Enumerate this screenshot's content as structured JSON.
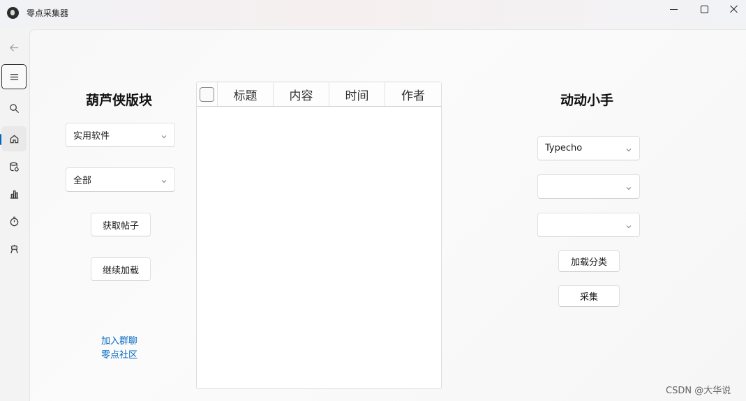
{
  "window": {
    "title": "零点采集器"
  },
  "nav": {
    "items": [
      "back-arrow-icon",
      "menu-icon",
      "search-icon",
      "home-icon",
      "database-icon",
      "bar-chart-icon",
      "timer-icon",
      "robot-icon"
    ],
    "active": "home-icon",
    "accent_color": "#0067c0"
  },
  "left_panel": {
    "title": "葫芦侠版块",
    "category_select": {
      "value": "实用软件"
    },
    "filter_select": {
      "value": "全部"
    },
    "fetch_button": "获取帖子",
    "load_more_button": "继续加载",
    "link_join_group": "加入群聊",
    "link_community": "零点社区"
  },
  "table": {
    "columns": [
      "标题",
      "内容",
      "时间",
      "作者"
    ],
    "rows": []
  },
  "right_panel": {
    "title": "动动小手",
    "platform_select": {
      "value": "Typecho"
    },
    "select_2": {
      "value": ""
    },
    "select_3": {
      "value": ""
    },
    "load_category_button": "加载分类",
    "collect_button": "采集"
  },
  "watermark": "CSDN @大华说"
}
